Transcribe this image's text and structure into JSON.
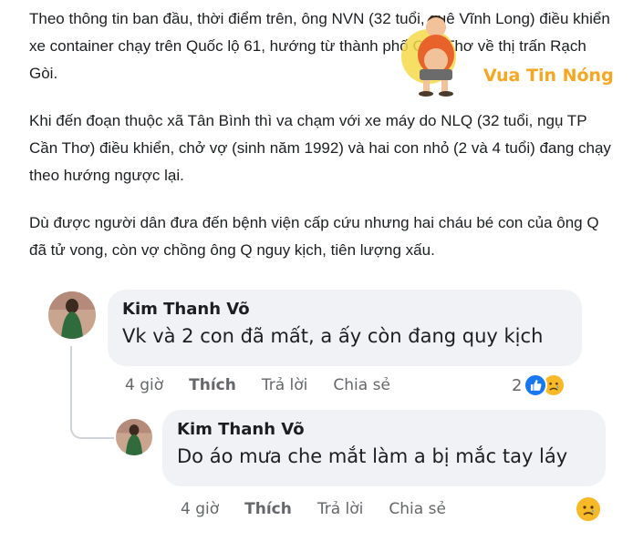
{
  "article": {
    "p1": "Theo thông tin ban đầu, thời điểm trên, ông NVN (32 tuổi, quê Vĩnh Long) điều khiển xe container chạy trên Quốc lộ 61, hướng từ thành phố Cần Thơ về thị trấn Rạch Gòi.",
    "p2": "Khi đến đoạn thuộc xã Tân Bình thì va chạm với xe máy do NLQ (32 tuổi, ngụ TP Cần Thơ) điều khiển, chở vợ (sinh năm 1992) và hai con nhỏ (2 và 4 tuổi) đang chạy theo hướng ngược lại.",
    "p3": "Dù được người dân đưa đến bệnh viện cấp cứu nhưng hai cháu bé con của ông Q đã tử vong, còn vợ chồng ông Q nguy kịch, tiên lượng xấu."
  },
  "watermark": {
    "text": "Vua Tin Nóng"
  },
  "comments": [
    {
      "author": "Kim Thanh Võ",
      "text": "Vk và 2 con đã mất, a ấy còn đang quy kịch",
      "time": "4 giờ",
      "like": "Thích",
      "reply": "Trả lời",
      "share": "Chia sẻ",
      "reaction_count": "2",
      "reactions": [
        "like-icon",
        "sad-icon"
      ]
    },
    {
      "author": "Kim Thanh Võ",
      "text": "Do áo mưa che mắt làm a bị mắc tay láy",
      "time": "4 giờ",
      "like": "Thích",
      "reply": "Trả lời",
      "share": "Chia sẻ",
      "reactions": [
        "sad-icon"
      ]
    }
  ],
  "colors": {
    "bubble": "#f0f2f5",
    "like_blue": "#1877f2",
    "sad_yellow": "#f7b928",
    "meta_gray": "#65676b",
    "watermark_orange": "#f5a623"
  }
}
